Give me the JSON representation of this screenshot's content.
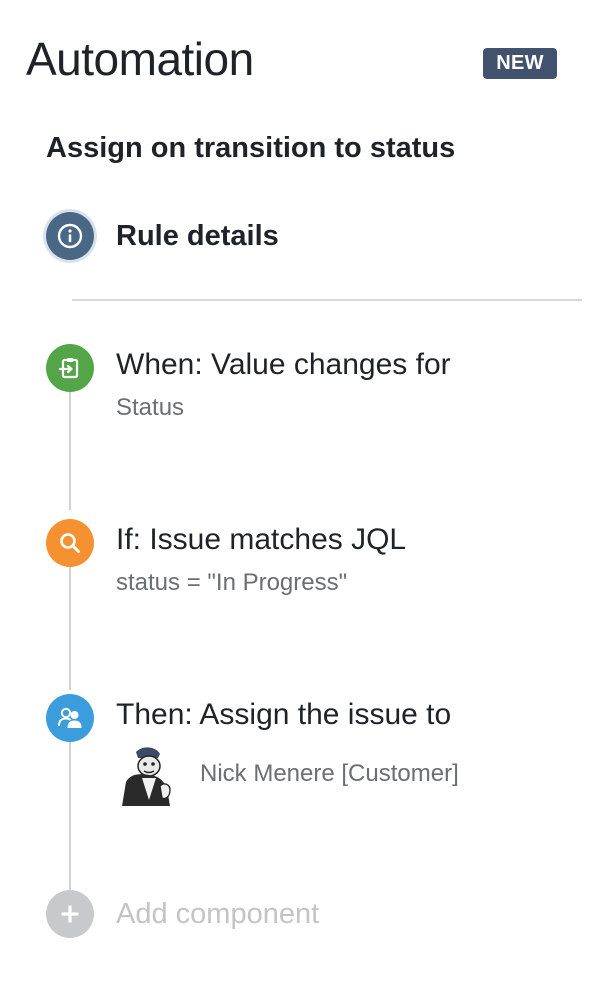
{
  "panel": {
    "title": "Automation",
    "badge": "NEW",
    "rule_name": "Assign on transition to status"
  },
  "rule_details": {
    "label": "Rule details",
    "icon": "info-icon",
    "color": "#4a6785"
  },
  "steps": [
    {
      "heading": "When: Value changes for",
      "detail": "Status",
      "icon": "trigger-icon",
      "color": "#53a548"
    },
    {
      "heading": "If: Issue matches JQL",
      "detail": "status = \"In Progress\"",
      "icon": "search-icon",
      "color": "#f59130"
    },
    {
      "heading": "Then: Assign the issue to",
      "assignee": "Nick Menere [Customer]",
      "icon": "assign-user-icon",
      "color": "#3b9ddb"
    }
  ],
  "add_component": {
    "label": "Add component",
    "icon": "plus-icon"
  }
}
